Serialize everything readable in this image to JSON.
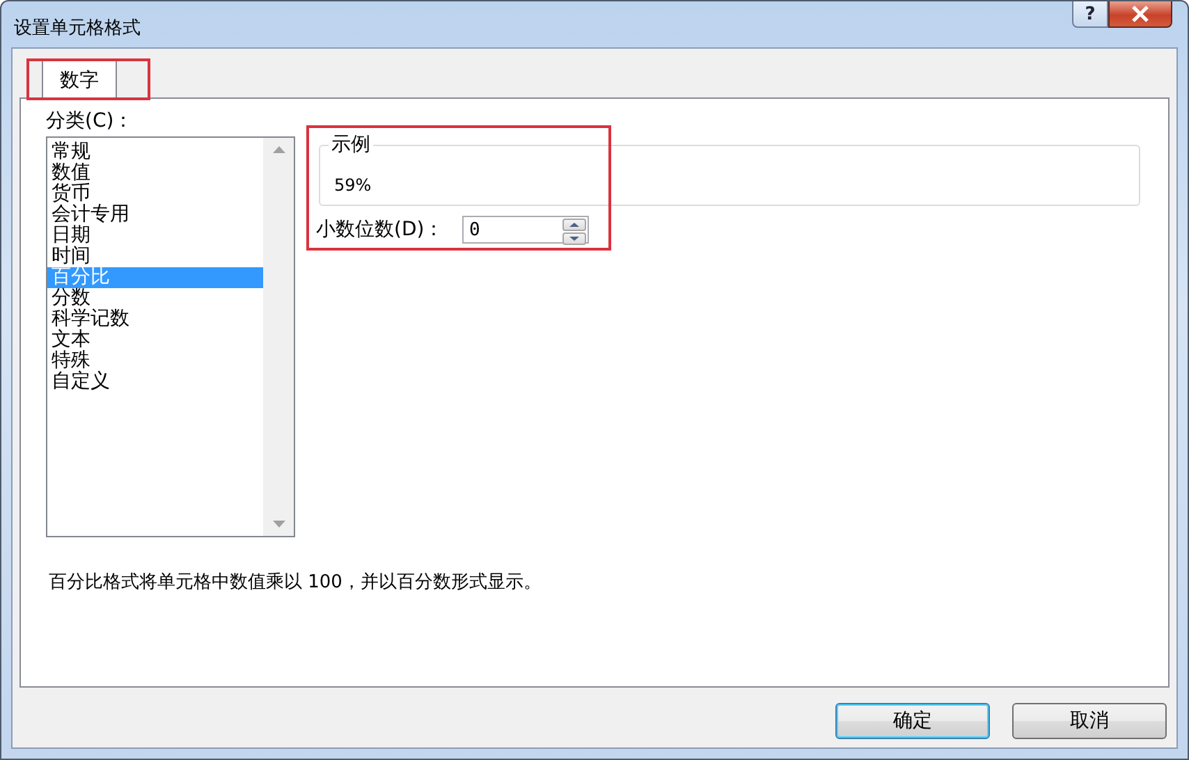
{
  "window": {
    "title": "设置单元格格式",
    "help_button": "?"
  },
  "tabs": [
    {
      "label": "数字",
      "selected": true
    }
  ],
  "category": {
    "label": "分类(C)：",
    "items": [
      {
        "label": "常规",
        "selected": false
      },
      {
        "label": "数值",
        "selected": false
      },
      {
        "label": "货币",
        "selected": false
      },
      {
        "label": "会计专用",
        "selected": false
      },
      {
        "label": "日期",
        "selected": false
      },
      {
        "label": "时间",
        "selected": false
      },
      {
        "label": "百分比",
        "selected": true
      },
      {
        "label": "分数",
        "selected": false
      },
      {
        "label": "科学记数",
        "selected": false
      },
      {
        "label": "文本",
        "selected": false
      },
      {
        "label": "特殊",
        "selected": false
      },
      {
        "label": "自定义",
        "selected": false
      }
    ]
  },
  "sample": {
    "legend": "示例",
    "value": "59%"
  },
  "decimal_places": {
    "label": "小数位数(D)：",
    "value": "0"
  },
  "description": "百分比格式将单元格中数值乘以 100，并以百分数形式显示。",
  "buttons": [
    {
      "label": "确定",
      "default": true
    },
    {
      "label": "取消",
      "default": false
    }
  ]
}
